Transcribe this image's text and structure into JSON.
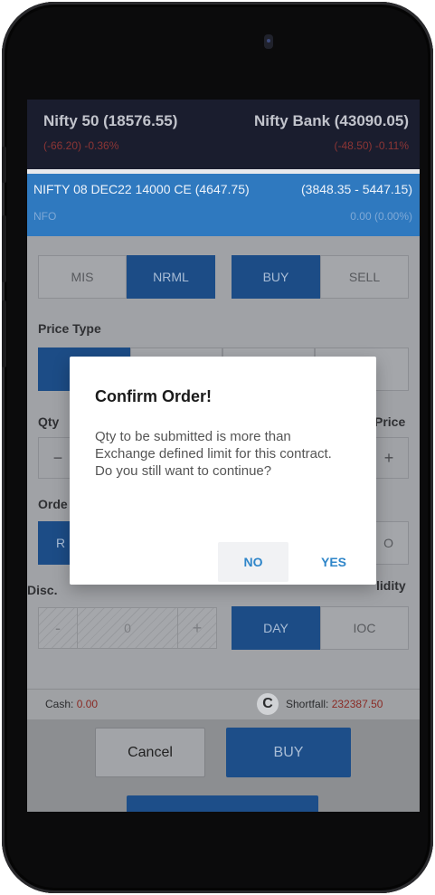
{
  "indices": [
    {
      "name": "Nifty 50 (18576.55)",
      "change": "(-66.20) -0.36%"
    },
    {
      "name": "Nifty Bank (43090.05)",
      "change": "(-48.50) -0.11%"
    }
  ],
  "instrument": {
    "name": "NIFTY 08 DEC22 14000 CE (4647.75)",
    "range": "(3848.35 - 5447.15)",
    "exchange": "NFO",
    "change": "0.00 (0.00%)"
  },
  "product_types": [
    "MIS",
    "NRML"
  ],
  "transaction_types": [
    "BUY",
    "SELL"
  ],
  "labels": {
    "price_type": "Price Type",
    "qty": "Qty",
    "price": "Price",
    "order": "Orde",
    "disc": "Disc.",
    "validity": "lidity"
  },
  "order_fragments": {
    "left": "R",
    "right": "O"
  },
  "stepper": {
    "minus": "−",
    "plus": "+",
    "disc_minus": "-",
    "disc_value": "0",
    "disc_plus": "+"
  },
  "validity_options": [
    "DAY",
    "IOC"
  ],
  "footer": {
    "cash_label": "Cash: ",
    "cash_value": "0.00",
    "shortfall_label": "Shortfall: ",
    "shortfall_value": "232387.50",
    "refresh_icon": "C"
  },
  "buttons": {
    "cancel": "Cancel",
    "buy": "BUY"
  },
  "dialog": {
    "title": "Confirm Order!",
    "message": "Qty to be submitted is more than Exchange defined limit for this contract. Do you still want to continue?",
    "no": "NO",
    "yes": "YES"
  },
  "colors": {
    "accent": "#2f79bf",
    "negative": "#d33a2f",
    "dialog_button": "#2f86c9"
  }
}
